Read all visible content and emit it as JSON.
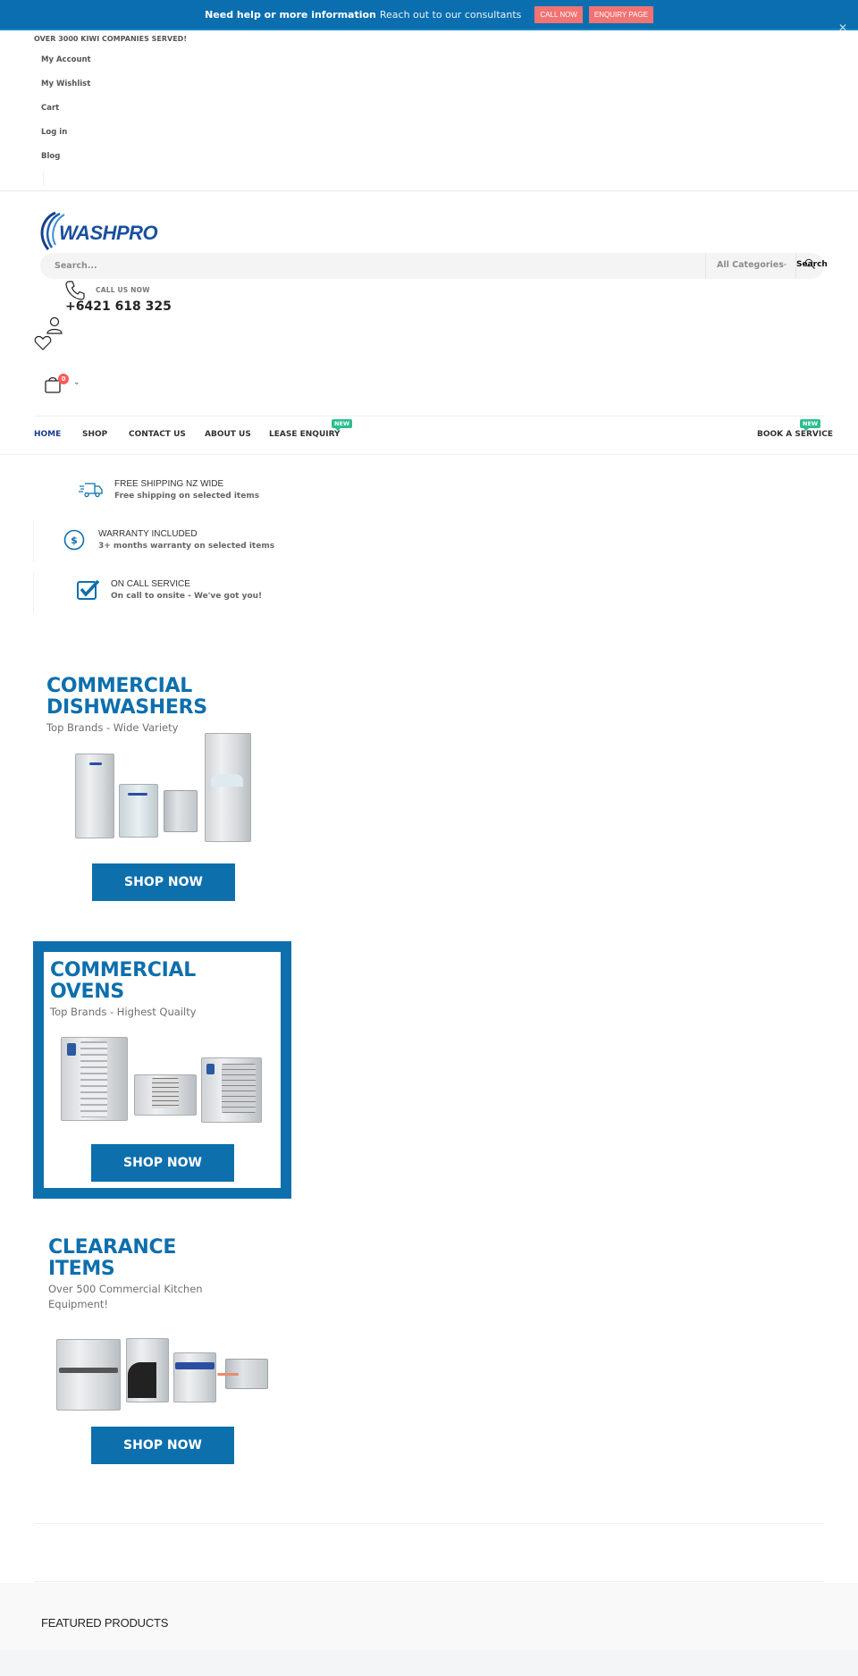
{
  "notice": {
    "strong_text": "Need help or more information",
    "text": "Reach out to our consultants",
    "call_now": "CALL NOW",
    "enquiry_page": "ENQUIRY PAGE",
    "close": "✕"
  },
  "header": {
    "tagline": "OVER 3000 KIWI COMPANIES SERVED!",
    "top_links": [
      "My Account",
      "My Wishlist",
      "Cart",
      "Log in",
      "Blog"
    ],
    "logo_text": "WASHPRO",
    "search": {
      "placeholder": "Search...",
      "category": "All Categories",
      "button": "Search"
    },
    "call_label": "CALL US NOW",
    "call_number": "+6421 618 325",
    "cart_count": "0"
  },
  "nav": {
    "items": [
      {
        "label": "HOME",
        "active": true
      },
      {
        "label": "SHOP"
      },
      {
        "label": "CONTACT US"
      },
      {
        "label": "ABOUT US"
      },
      {
        "label": "LEASE ENQUIRY",
        "badge": "NEW"
      },
      {
        "label": "BOOK A SERVICE",
        "badge": "NEW"
      }
    ]
  },
  "features": [
    {
      "icon": "truck-icon",
      "title": "FREE SHIPPING NZ WIDE",
      "subtitle": "Free shipping on selected items"
    },
    {
      "icon": "dollar-circle-icon",
      "title": "WARRANTY INCLUDED",
      "subtitle": "3+ months warranty on selected items"
    },
    {
      "icon": "checkbox-icon",
      "title": "ON CALL SERVICE",
      "subtitle": "On call to onsite - We've got you!"
    }
  ],
  "banners": [
    {
      "title_line1": "COMMERCIAL",
      "title_line2": "DISHWASHERS",
      "subtitle": "Top Brands - Wide Variety",
      "button": "SHOP NOW"
    },
    {
      "title_line1": "COMMERCIAL",
      "title_line2": "OVENS",
      "subtitle": "Top Brands - Highest Quailty",
      "button": "SHOP NOW"
    },
    {
      "title_line1": "CLEARANCE",
      "title_line2": "ITEMS",
      "subtitle_line1": "Over 500 Commercial Kitchen",
      "subtitle_line2": "Equipment!",
      "button": "SHOP NOW"
    }
  ],
  "featured": {
    "title": "FEATURED PRODUCTS"
  },
  "colors": {
    "brand_blue": "#0e6fad",
    "notice_bg": "#0a6eaf",
    "notice_button": "#f17373",
    "badge_new": "#2bbf8f",
    "cart_badge": "#ff5b5b",
    "nav_active": "#1a3d8f"
  }
}
